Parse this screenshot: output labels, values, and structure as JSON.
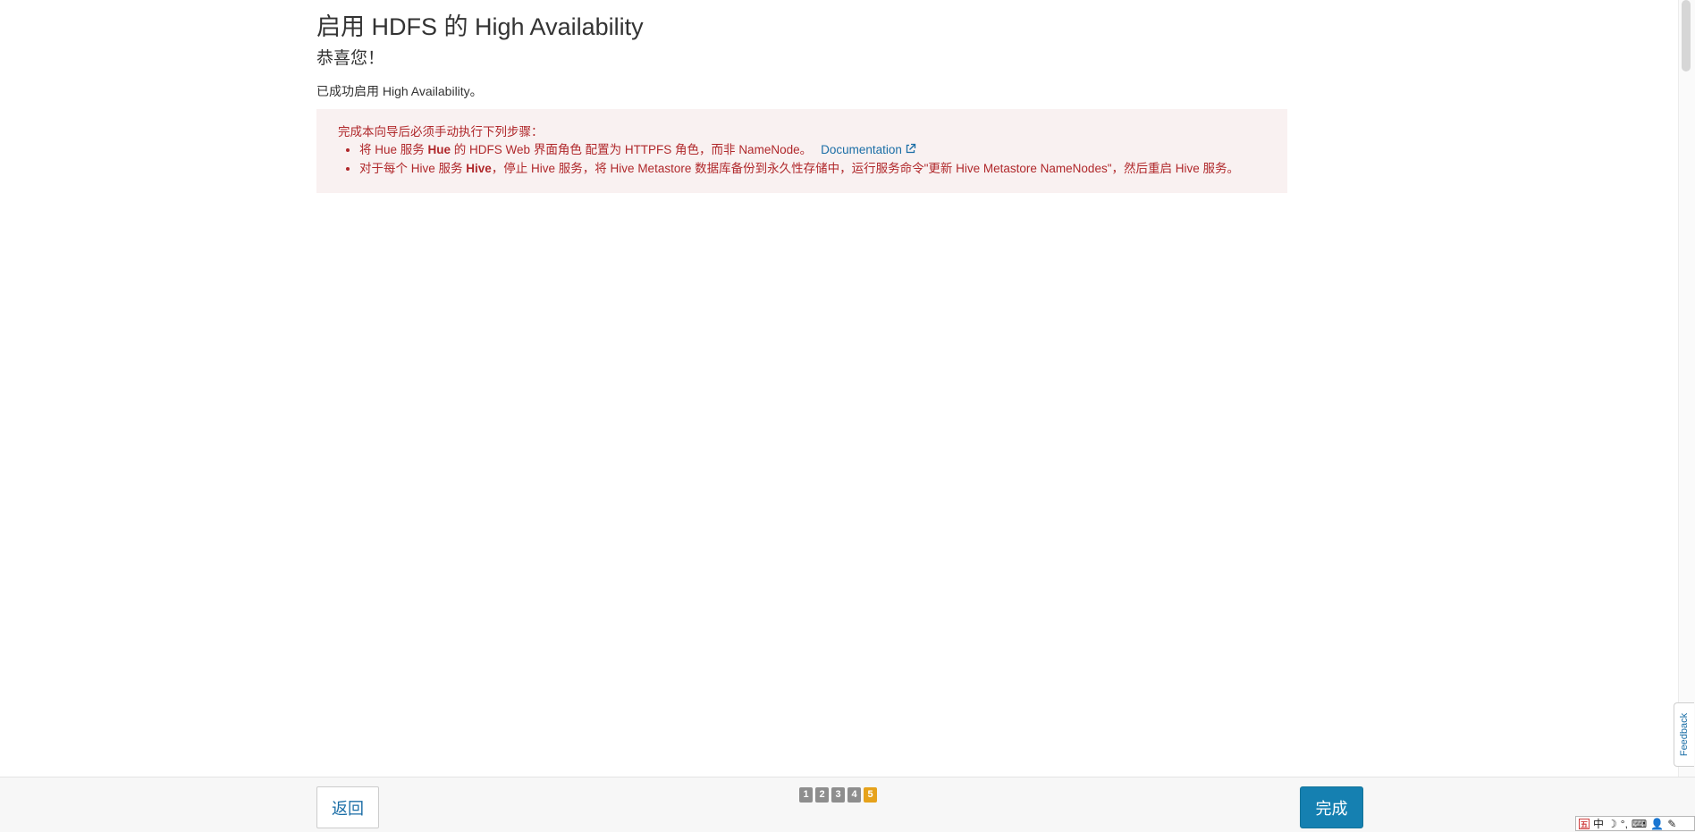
{
  "header": {
    "title": "启用 HDFS 的 High Availability",
    "congrats": "恭喜您！",
    "success": "已成功启用 High Availability。"
  },
  "alert": {
    "title": "完成本向导后必须手动执行下列步骤：",
    "item1": {
      "pre": "将 Hue 服务 ",
      "bold": "Hue",
      "post": " 的 HDFS Web 界面角色 配置为 HTTPFS 角色，而非 NameNode。",
      "link_text": "Documentation",
      "link_icon": "external-link-icon"
    },
    "item2": {
      "pre": "对于每个 Hive 服务 ",
      "bold": "Hive",
      "post": "，停止 Hive 服务，将 Hive Metastore 数据库备份到永久性存储中，运行服务命令\"更新 Hive Metastore NameNodes\"，然后重启 Hive 服务。"
    },
    "colors": {
      "background": "#f9f1f1",
      "text": "#b0282b"
    }
  },
  "footer": {
    "back_label": "返回",
    "finish_label": "完成",
    "steps": [
      "1",
      "2",
      "3",
      "4",
      "5"
    ],
    "active_step": "5",
    "colors": {
      "primary": "#1580b1",
      "step_active": "#e6a21b",
      "step_inactive": "#8e8e8e"
    }
  },
  "feedback": {
    "label": "Feedback"
  },
  "ime": {
    "logo_icon": "ime-logo-icon",
    "lang": "中",
    "icons": [
      "moon-icon",
      "punctuation-icon",
      "keyboard-icon",
      "user-icon",
      "wrench-icon"
    ]
  }
}
